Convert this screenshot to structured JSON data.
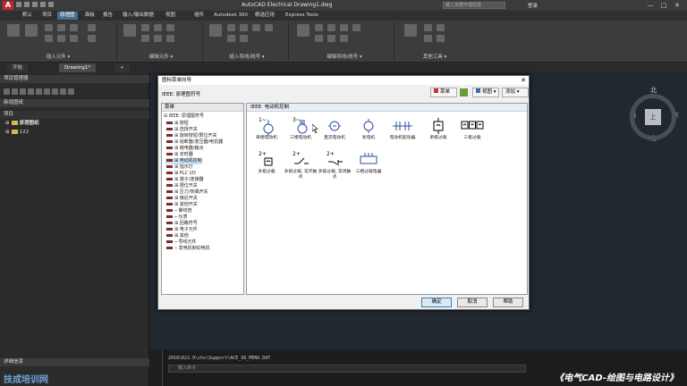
{
  "titlebar": {
    "logo": "A",
    "title": "AutoCAD Electrical    Drawing1.dwg",
    "search_placeholder": "键入关键字或短语",
    "user": "登录",
    "min": "—",
    "max": "□",
    "close": "✕"
  },
  "menu": [
    "默认",
    "项目",
    "原理图",
    "面板",
    "报告",
    "输入/输出数据",
    "视图",
    "插件",
    "Autodesk 360",
    "精选应用",
    "Express Tools"
  ],
  "ribbon": {
    "panels": [
      "插入元件 ▾",
      "编辑元件 ▾",
      "插入导线/线号 ▾",
      "编辑导线/线号 ▾",
      "其他工具 ▾"
    ]
  },
  "file_tabs": [
    "开始",
    "Drawing1*",
    "+"
  ],
  "left_panel": {
    "header": "项目管理器",
    "sub_header": "新增图纸",
    "section": "项目",
    "projects": [
      "原理图纸",
      "122"
    ],
    "footer": "详细信息"
  },
  "dialog": {
    "title": "图标菜单向导",
    "close": "✕",
    "path_label": "IEEE: 原理图符号",
    "toolbar": {
      "menu": "菜单",
      "view": "视图 ▾",
      "add": "添加 ▾"
    },
    "tree_header": "菜单",
    "tree": [
      "⊟ IEEE: 原理图符号",
      "⊞ 按钮",
      "⊞ 选择开关",
      "⊞ 旋转按钮/限位开关",
      "⊞ 熔断器/变压器/电抗器",
      "⊞ 继电器/触点",
      "⊞ 定时器",
      "⊞ 电动机控制",
      "⊞ 指示灯",
      "⊞ PLC I/O",
      "⊞ 端子/连接器",
      "⊞ 限位开关",
      "⊞ 压力/热偶开关",
      "⊞ 接近开关",
      "⊞ 其他开关",
      "─ 螺线管",
      "─ 仪表",
      "⊞ 回路符号",
      "⊞ 电子元件",
      "⊞ 其他",
      "─ 导线元件",
      "─ 发电机制动电机"
    ],
    "main_header": "IEEE: 电动机控制",
    "symbols": [
      {
        "top": "1~",
        "label": "单相电动机"
      },
      {
        "top": "3~",
        "label": "三相电动机"
      },
      {
        "top": "",
        "label": "直流电动机"
      },
      {
        "top": "",
        "label": "发电机"
      },
      {
        "top": "",
        "label": "电动机起动器"
      },
      {
        "top": "",
        "label": "单极过载"
      },
      {
        "top": "",
        "label": "三极过载"
      },
      {
        "top": "2+",
        "label": "多极过载"
      },
      {
        "top": "2+",
        "label": "多极过载, 常开触点"
      },
      {
        "top": "2+",
        "label": "多极过载, 常闭触点"
      },
      {
        "top": "",
        "label": "三相过载电器"
      }
    ],
    "buttons": {
      "ok": "确定",
      "cancel": "取消",
      "help": "帮助"
    }
  },
  "viewcube": {
    "north": "北",
    "south": "南",
    "east": "东",
    "west": "西",
    "top": "上"
  },
  "command": {
    "history": "2018\\R22.0\\chs\\Support\\ACE_SO_MENU.DAT",
    "input_placeholder": "键入命令"
  },
  "course_title": "《电气CAD-绘图与电路设计》",
  "watermark": "技成培训网"
}
